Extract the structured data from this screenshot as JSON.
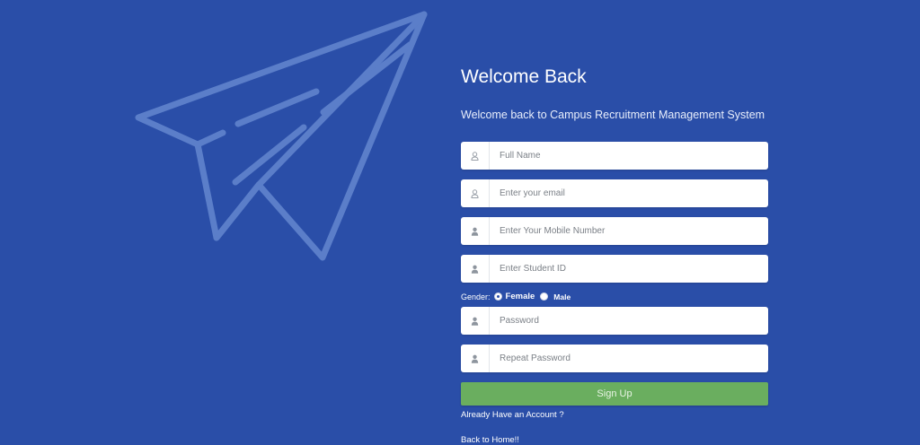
{
  "page": {
    "title": "Welcome Back",
    "subtitle": "Welcome back to Campus Recruitment Management System"
  },
  "form": {
    "full_name": {
      "placeholder": "Full Name",
      "icon": "user-icon"
    },
    "email": {
      "placeholder": "Enter your email",
      "icon": "user-icon"
    },
    "mobile": {
      "placeholder": "Enter Your Mobile Number",
      "icon": "person-icon"
    },
    "student_id": {
      "placeholder": "Enter Student ID",
      "icon": "person-icon"
    },
    "gender": {
      "label": "Gender:",
      "options": [
        "Female",
        "Male"
      ],
      "selected": "Female"
    },
    "password": {
      "placeholder": "Password",
      "icon": "person-icon"
    },
    "repeat_password": {
      "placeholder": "Repeat Password",
      "icon": "person-icon"
    },
    "signup_label": "Sign Up"
  },
  "links": {
    "have_account": "Already Have an Account ?",
    "back_home": "Back to Home!!"
  },
  "colors": {
    "background": "#2a4ea8",
    "signup_button": "#6aae5f",
    "plane_outline": "#5b7ec9"
  }
}
